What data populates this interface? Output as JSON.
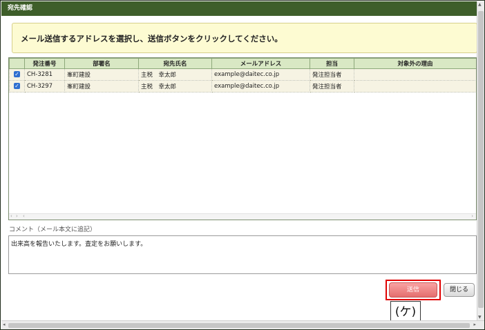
{
  "dialog": {
    "title": "宛先確認"
  },
  "instruction": {
    "text": "メール送信するアドレスを選択し、送信ボタンをクリックしてください。"
  },
  "table": {
    "columns": [
      "",
      "発注番号",
      "部署名",
      "宛先氏名",
      "メールアドレス",
      "担当",
      "対象外の理由"
    ],
    "rows": [
      {
        "checked": true,
        "order_no": "CH-3281",
        "department": "峯町建設",
        "recipient": "主税　幸太郎",
        "email": "example@daitec.co.jp",
        "role": "発注担当者",
        "reason": ""
      },
      {
        "checked": true,
        "order_no": "CH-3297",
        "department": "峯町建設",
        "recipient": "主税　幸太郎",
        "email": "example@daitec.co.jp",
        "role": "発注担当者",
        "reason": ""
      }
    ]
  },
  "comment": {
    "label": "コメント（メール本文に追記）",
    "value": "出来高を報告いたします。査定をお願いします。"
  },
  "buttons": {
    "send": "送信",
    "close": "閉じる"
  },
  "annotation": {
    "callout": "(ケ)"
  },
  "colors": {
    "titlebar": "#3e5e2a",
    "instruction_bg": "#fdfbd2",
    "header_bg": "#d9e8c4",
    "send_button": "#e56e6e",
    "highlight": "#e00000",
    "checkbox": "#2f6fd0"
  }
}
